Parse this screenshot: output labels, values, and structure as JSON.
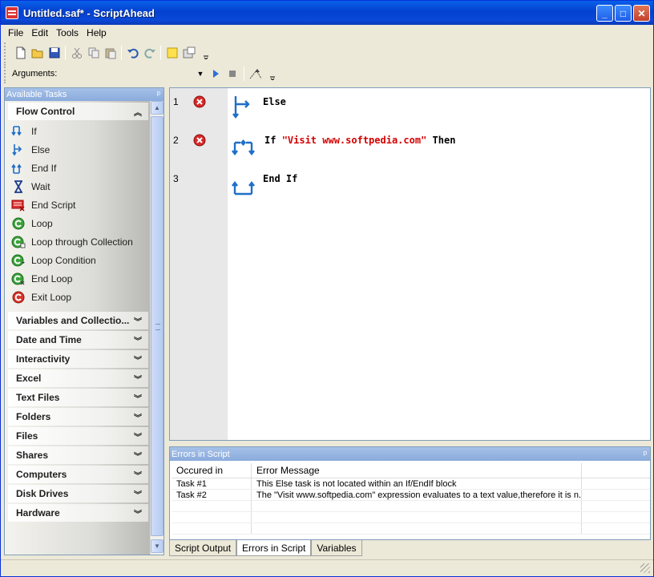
{
  "window": {
    "title": "Untitled.saf* - ScriptAhead",
    "min_glyph": "_",
    "max_glyph": "□",
    "close_glyph": "✕"
  },
  "menu": [
    "File",
    "Edit",
    "Tools",
    "Help"
  ],
  "toolbar": {
    "arguments_label": "Arguments:"
  },
  "tasks_panel": {
    "title": "Available Tasks",
    "pin_glyph": "ᵖ",
    "flow_control": {
      "label": "Flow Control",
      "items": [
        "If",
        "Else",
        "End If",
        "Wait",
        "End Script",
        "Loop",
        "Loop through Collection",
        "Loop Condition",
        "End Loop",
        "Exit Loop"
      ]
    },
    "groups": [
      "Variables and Collectio...",
      "Date and Time",
      "Interactivity",
      "Excel",
      "Text Files",
      "Folders",
      "Files",
      "Shares",
      "Computers",
      "Disk Drives",
      "Hardware"
    ]
  },
  "script": {
    "lines": [
      {
        "num": "1",
        "keyword": "Else",
        "has_error": true
      },
      {
        "num": "2",
        "pre": "If ",
        "string": "\"Visit www.softpedia.com\"",
        "post": " Then",
        "has_error": true
      },
      {
        "num": "3",
        "keyword": "End If",
        "has_error": false
      }
    ]
  },
  "errors_panel": {
    "title": "Errors in Script",
    "pin_glyph": "ᵖ",
    "columns": [
      "Occured in",
      "Error Message",
      ""
    ],
    "rows": [
      [
        "Task #1",
        "This Else task is not located within an If/EndIf block"
      ],
      [
        "Task #2",
        "The \"Visit www.softpedia.com\" expression evaluates to a text value,therefore it is n..."
      ]
    ]
  },
  "bottom_tabs": [
    "Script Output",
    "Errors in Script",
    "Variables"
  ],
  "colors": {
    "accent_title": "#0a5fe9",
    "error_red": "#d40000",
    "icon_blue": "#1f6fc8"
  }
}
